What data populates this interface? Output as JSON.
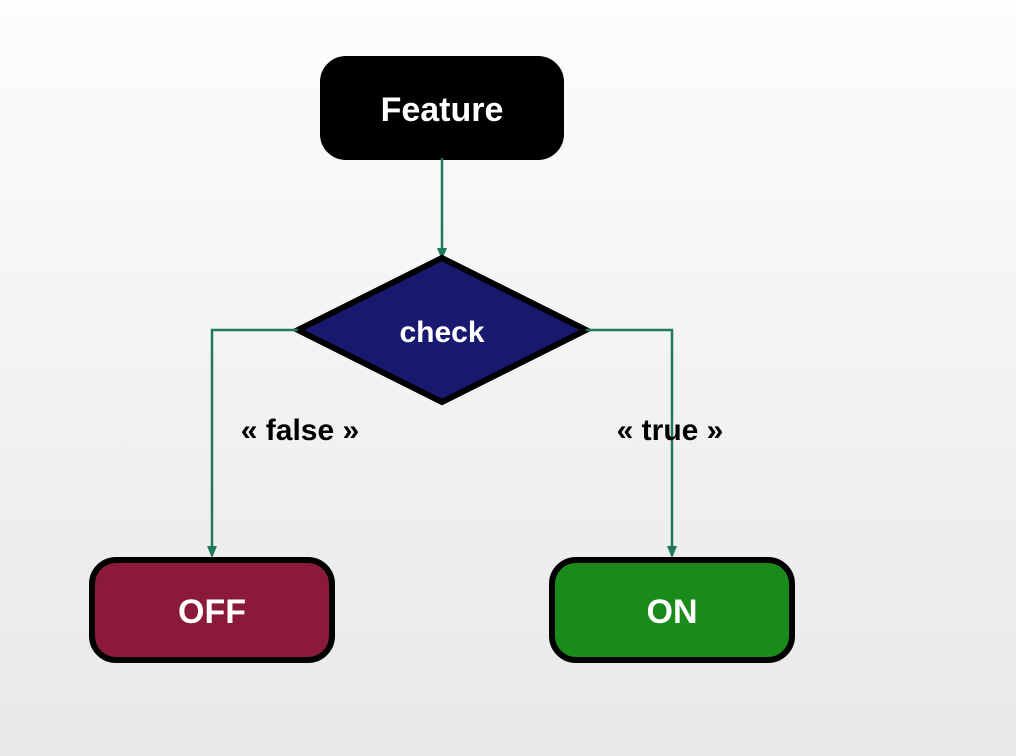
{
  "diagram": {
    "nodes": {
      "feature": {
        "label": "Feature",
        "fill": "#000000",
        "text": "#ffffff"
      },
      "check": {
        "label": "check",
        "fill": "#191970",
        "text": "#ffffff"
      },
      "off": {
        "label": "OFF",
        "fill": "#8b1a3a",
        "text": "#ffffff"
      },
      "on": {
        "label": "ON",
        "fill": "#1a8b1a",
        "text": "#ffffff"
      }
    },
    "edges": {
      "false_label": "« false »",
      "true_label": "« true »"
    },
    "colors": {
      "arrow": "#1f7a5a",
      "stroke": "#000000"
    }
  }
}
